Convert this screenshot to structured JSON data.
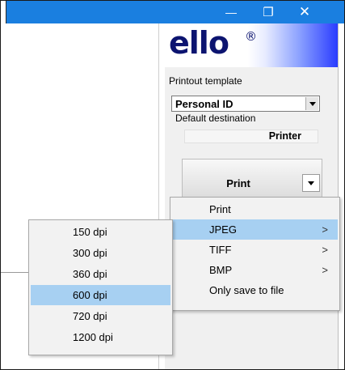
{
  "window": {
    "minimize_glyph": "—",
    "maximize_glyph": "❐",
    "close_glyph": "✕",
    "titlebar_color": "#1a7fe0"
  },
  "logo": {
    "text": "ello",
    "registered": "®"
  },
  "template": {
    "label": "Printout template",
    "selected": "Personal ID"
  },
  "destination": {
    "label": "Default destination",
    "value": "Printer"
  },
  "print_button": {
    "label": "Print"
  },
  "context_menu": {
    "items": [
      {
        "label": "Print",
        "submenu": false,
        "highlighted": false
      },
      {
        "label": "JPEG",
        "submenu": true,
        "highlighted": true
      },
      {
        "label": "TIFF",
        "submenu": true,
        "highlighted": false
      },
      {
        "label": "BMP",
        "submenu": true,
        "highlighted": false
      },
      {
        "label": "Only save to file",
        "submenu": false,
        "highlighted": false
      }
    ],
    "submenu_arrow": ">"
  },
  "dpi_menu": {
    "items": [
      {
        "label": "150 dpi",
        "highlighted": false
      },
      {
        "label": "300 dpi",
        "highlighted": false
      },
      {
        "label": "360 dpi",
        "highlighted": false
      },
      {
        "label": "600 dpi",
        "highlighted": true
      },
      {
        "label": "720 dpi",
        "highlighted": false
      },
      {
        "label": "1200 dpi",
        "highlighted": false
      }
    ]
  },
  "colors": {
    "highlight": "#a7d0f2",
    "logo_text": "#0c1470"
  }
}
